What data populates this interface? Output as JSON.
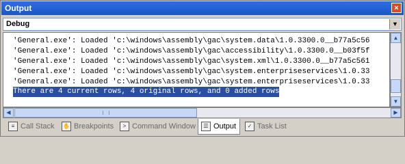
{
  "window": {
    "title": "Output"
  },
  "pane_selector": {
    "value": "Debug"
  },
  "output_lines": [
    "'General.exe': Loaded 'c:\\windows\\assembly\\gac\\system.data\\1.0.3300.0__b77a5c56",
    "'General.exe': Loaded 'c:\\windows\\assembly\\gac\\accessibility\\1.0.3300.0__b03f5f",
    "'General.exe': Loaded 'c:\\windows\\assembly\\gac\\system.xml\\1.0.3300.0__b77a5c561",
    "'General.exe': Loaded 'c:\\windows\\assembly\\gac\\system.enterpriseservices\\1.0.33",
    "'General.exe': Loaded 'c:\\windows\\assembly\\gac\\system.enterpriseservices\\1.0.33",
    "There are 4 current rows, 4 original rows, and 0 added rows"
  ],
  "tabs": [
    {
      "label": "Call Stack",
      "icon": "call-stack-icon"
    },
    {
      "label": "Breakpoints",
      "icon": "breakpoints-icon"
    },
    {
      "label": "Command Window",
      "icon": "command-window-icon"
    },
    {
      "label": "Output",
      "icon": "output-icon",
      "active": true
    },
    {
      "label": "Task List",
      "icon": "task-list-icon"
    }
  ]
}
